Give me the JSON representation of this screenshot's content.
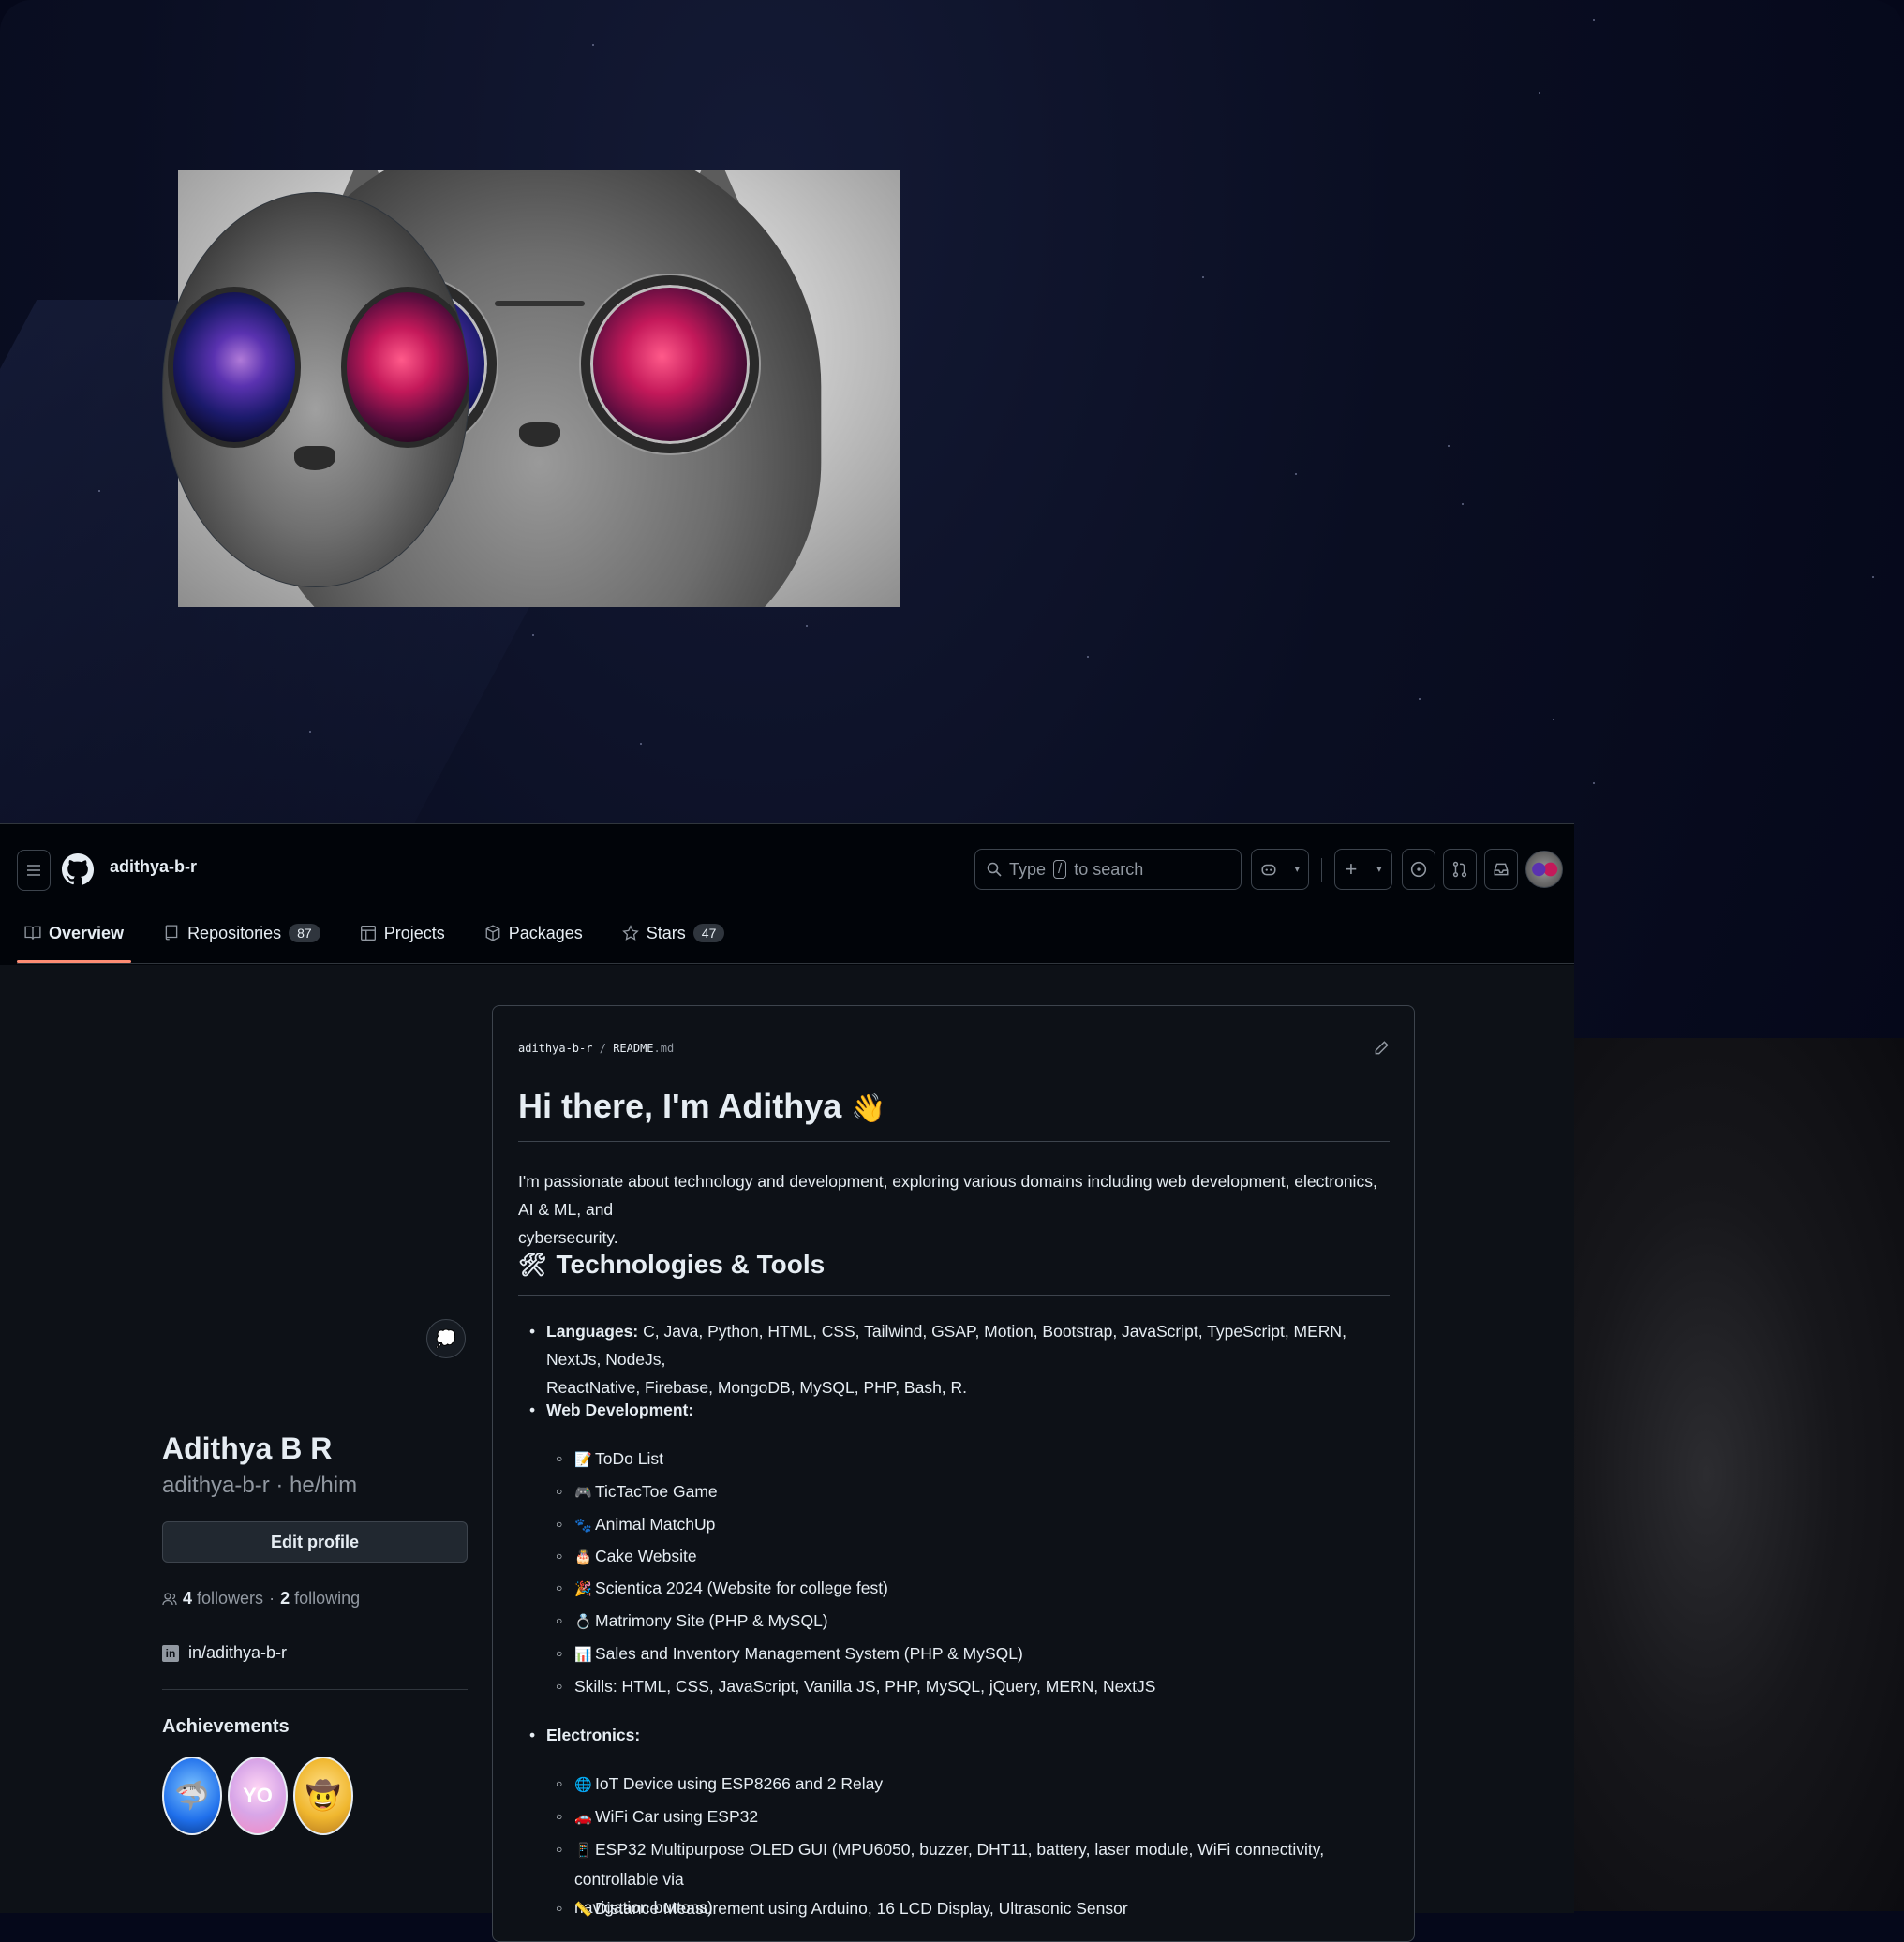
{
  "user": {
    "login": "adithya-b-r",
    "display_name": "Adithya B R",
    "login_pronouns": "adithya-b-r · he/him",
    "edit_profile_label": "Edit profile",
    "followers_count": "4",
    "followers_label": "followers",
    "separator": "·",
    "following_count": "2",
    "following_label": "following",
    "linkedin": "in/adithya-b-r",
    "status_emoji": "💭"
  },
  "search": {
    "prefix": "Type",
    "key": "/",
    "suffix": "to search"
  },
  "nav": [
    {
      "label": "Overview",
      "count": null,
      "icon": "book-icon"
    },
    {
      "label": "Repositories",
      "count": "87",
      "icon": "repo-icon"
    },
    {
      "label": "Projects",
      "count": null,
      "icon": "table-icon"
    },
    {
      "label": "Packages",
      "count": null,
      "icon": "package-icon"
    },
    {
      "label": "Stars",
      "count": "47",
      "icon": "star-icon"
    }
  ],
  "achievements": {
    "title": "Achievements",
    "badges": [
      {
        "name": "pull-shark",
        "color": "#1f6feb"
      },
      {
        "name": "yolo",
        "color": "#d8a6e8"
      },
      {
        "name": "quickdraw",
        "color": "#f0b72f"
      }
    ]
  },
  "readme": {
    "crumb_owner": "adithya-b-r",
    "crumb_sep": "/",
    "crumb_file": "README",
    "crumb_ext": ".md",
    "title": "Hi there, I'm Adithya",
    "title_emoji": "👋",
    "intro_line1": "I'm passionate about technology and development, exploring various domains including web development, electronics, AI & ML, and",
    "intro_line2": "cybersecurity.",
    "tech_heading": "Technologies & Tools",
    "tech_emoji": "🛠",
    "languages_label": "Languages:",
    "languages_line1": " C, Java, Python, HTML, CSS, Tailwind, GSAP, Motion, Bootstrap, JavaScript, TypeScript, MERN, NextJs, NodeJs,",
    "languages_line2": "ReactNative, Firebase, MongoDB, MySQL, PHP, Bash, R.",
    "web_label": "Web Development:",
    "web_items": [
      {
        "emoji": "📝",
        "text": "ToDo List"
      },
      {
        "emoji": "🎮",
        "text": "TicTacToe Game"
      },
      {
        "emoji": "🐾",
        "text": "Animal MatchUp"
      },
      {
        "emoji": "🎂",
        "text": "Cake Website"
      },
      {
        "emoji": "🎉",
        "text": "Scientica 2024 (Website for college fest)"
      },
      {
        "emoji": "💍",
        "text": "Matrimony Site (PHP & MySQL)"
      },
      {
        "emoji": "📊",
        "text": "Sales and Inventory Management System (PHP & MySQL)"
      },
      {
        "emoji": "",
        "text": "Skills: HTML, CSS, JavaScript, Vanilla JS, PHP, MySQL, jQuery, MERN, NextJS"
      }
    ],
    "electronics_label": "Electronics:",
    "electronics_items": [
      {
        "emoji": "🌐",
        "text": "IoT Device using ESP8266 and 2 Relay"
      },
      {
        "emoji": "🚗",
        "text": "WiFi Car using ESP32"
      },
      {
        "emoji": "📱",
        "text": "ESP32 Multipurpose OLED GUI (MPU6050, buzzer, DHT11, battery, laser module, WiFi connectivity, controllable via"
      },
      {
        "emoji": "",
        "text": "navigation buttons)"
      },
      {
        "emoji": "📏",
        "text": "Distance Measurement using Arduino, 16 LCD Display, Ultrasonic Sensor"
      }
    ]
  }
}
